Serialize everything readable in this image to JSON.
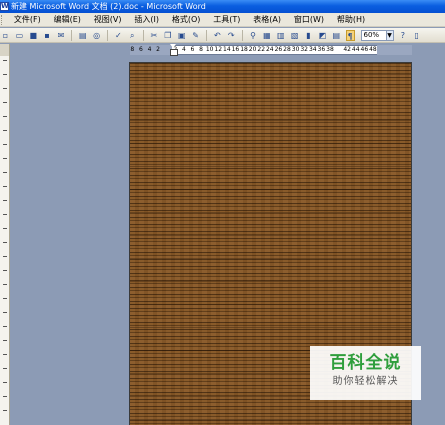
{
  "window": {
    "title": "新建 Microsoft Word 文档 (2).doc - Microsoft Word"
  },
  "menubar": {
    "items": [
      "文件(F)",
      "编辑(E)",
      "视图(V)",
      "插入(I)",
      "格式(O)",
      "工具(T)",
      "表格(A)",
      "窗口(W)",
      "帮助(H)"
    ]
  },
  "toolbar": {
    "zoom_value": "60%"
  },
  "ruler": {
    "ticks": [
      "8",
      "6",
      "4",
      "2",
      "",
      "2",
      "4",
      "6",
      "8",
      "10",
      "12",
      "14",
      "16",
      "18",
      "20",
      "22",
      "24",
      "26",
      "28",
      "30",
      "32",
      "34",
      "36",
      "38",
      "",
      "42",
      "44",
      "46",
      "48"
    ]
  },
  "document": {
    "page_background": "wood-grain texture",
    "wood_color": "#7a4e22"
  },
  "watermark": {
    "title": "百科全说",
    "subtitle": "助你轻松解决",
    "color": "#2f9e3c"
  }
}
